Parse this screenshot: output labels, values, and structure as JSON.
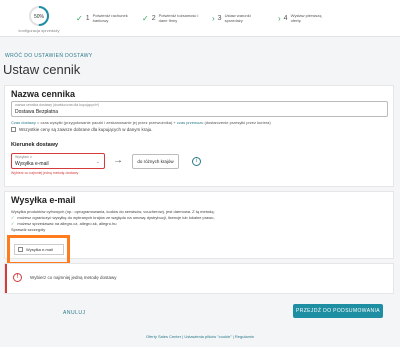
{
  "stepper": {
    "progress_text": "50%",
    "progress_value": 0.5,
    "progress_label": "konfiguracja sprzedaży",
    "steps": [
      {
        "num": "1",
        "label": "Potwierdź rachunek bankowy"
      },
      {
        "num": "2",
        "label": "Potwierdź tożsamość i dane firmy"
      },
      {
        "num": "3",
        "label": "Ustaw warunki sprzedaży"
      },
      {
        "num": "4",
        "label": "Wystaw pierwszą ofertę"
      }
    ]
  },
  "header": {
    "back_link": "WRÓĆ DO USTAWIEŃ DOSTAWY",
    "title": "Ustaw cennik"
  },
  "pricelist": {
    "section_title": "Nazwa cennika",
    "name_label": "nazwa cennika dostawy (dowidoczna dla kupujących*)",
    "name_value": "Dostawa Bezpłatna",
    "info_link1": "Czas dostawy",
    "info_text1": " = czas wysyłki (przygotowanie paczki i zeskanowanie jej przez przewoźnika) + ",
    "info_link2": "czas przewozu",
    "info_text2": " (dostarczenie przesyłki przez kuriera)",
    "checkbox_label": "Wszystkie ceny są zawsze dobrane dla kupujących w danym kraju.",
    "direction_title": "Kierunek dostawy",
    "select_label": "Wysyłam z",
    "select_value": "Wysyłka e-mail",
    "select_error": "Wybierz co najmniej jedną metodę dostawy",
    "destination": "do różnych krajów"
  },
  "email_shipping": {
    "section_title": "Wysyłka e-mail",
    "desc": "Wysyłka produktów cyfrowych (np.: oprogramowania, kodów do serwisów, voucherów), jest darmowa. Z tą metodą:",
    "bullets": [
      "możesz ograniczyć wysyłkę do wybranych krajów ze względu na umowę dystrybucji, licencje lub lokalne prawo,",
      "możesz sprzedawać na allegro.cz, allegro.sk, allegro.hu"
    ],
    "details_link": "Sprawdź szczegóły",
    "checkbox_label": "Wysyłka e-mail"
  },
  "alert": {
    "text": "Wybierz co najmniej jedną metodę dostawy"
  },
  "actions": {
    "cancel": "ANULUJ",
    "primary": "PRZEJDŹ DO PODSUMOWANIA"
  },
  "footer": {
    "text": "Oferty Sales Center | Ustawienia plików \"cookie\" | Regulamin"
  },
  "colors": {
    "accent": "#1e8fa3",
    "error": "#d43b3b",
    "highlight": "#ff7b1e",
    "success": "#3aa35b"
  }
}
